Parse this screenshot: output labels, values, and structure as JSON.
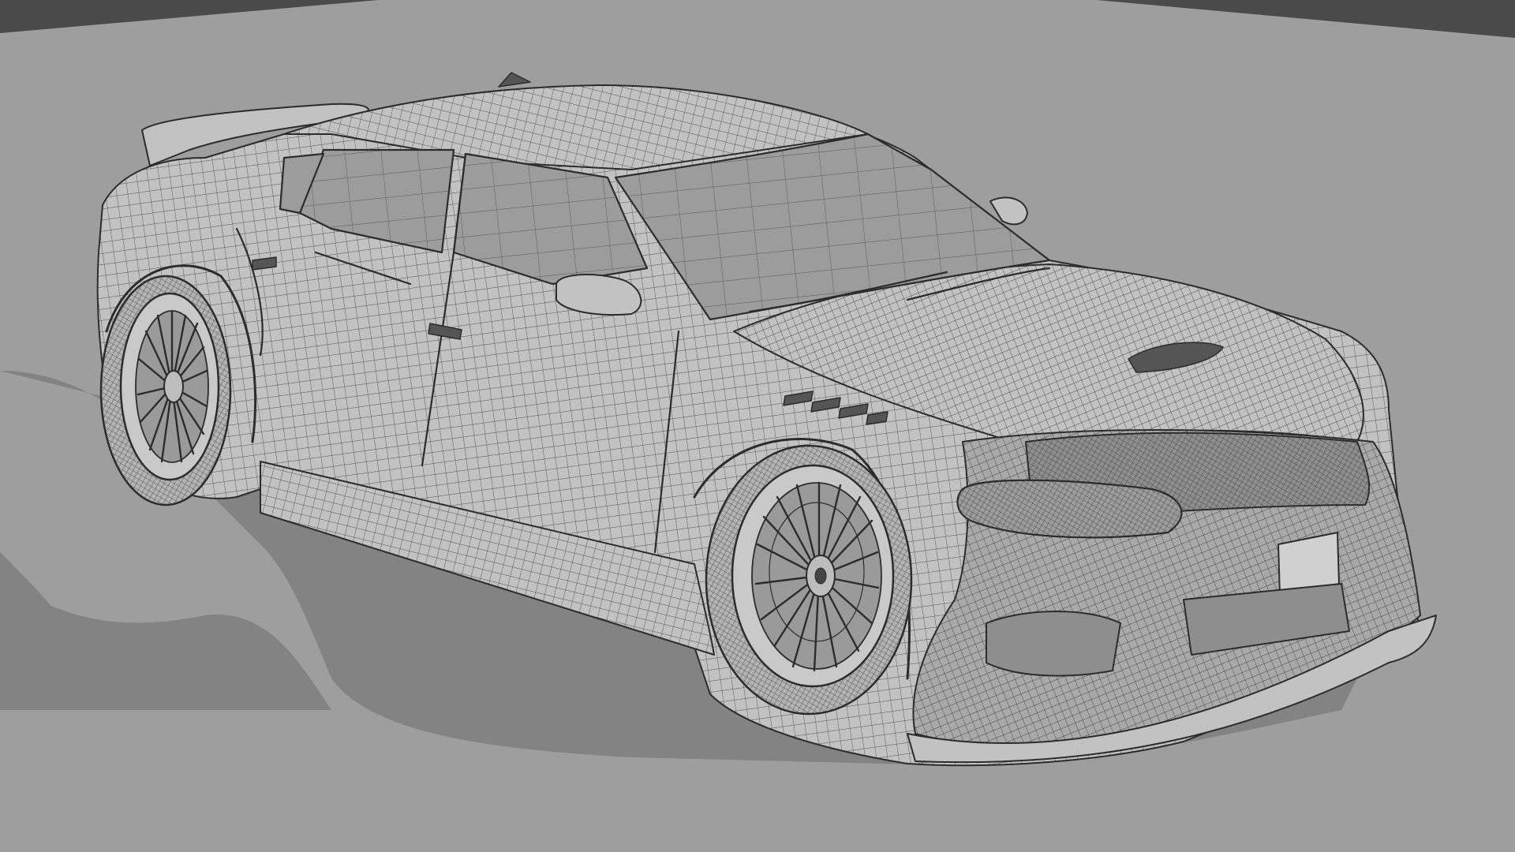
{
  "viewport": {
    "mode": "wireframe-on-shaded",
    "background_color": "#a3a3a3",
    "floor_color": "#9e9e9e",
    "shadow_color": "#838383",
    "dark_band_color": "#4a4a4a"
  },
  "model": {
    "subject": "car",
    "body_shade": "#c2c2c2",
    "body_shade_dark": "#a9a9a9",
    "wire_color": "#2c2c2c",
    "window_shade": "#9c9c9c",
    "tire_shade": "#b3b3b3"
  }
}
